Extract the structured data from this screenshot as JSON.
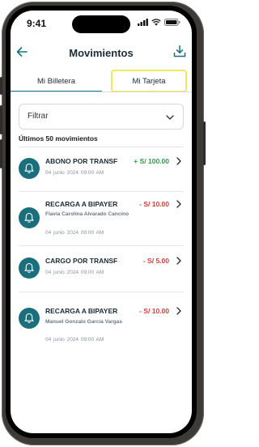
{
  "status_bar": {
    "time": "9:41"
  },
  "header": {
    "title": "Movimientos"
  },
  "tabs": [
    {
      "label": "Mi Billetera",
      "active": true
    },
    {
      "label": "Mi Tarjeta",
      "active": false
    }
  ],
  "filter": {
    "label": "Filtrar"
  },
  "section": {
    "title": "Últimos 50 movimientos"
  },
  "transactions": [
    {
      "title": "ABONO POR TRANSF",
      "amount": "+ S/ 100.00",
      "type": "credit",
      "name": "",
      "date": "04 junio 2024 09:00 AM"
    },
    {
      "title": "RECARGA A BIPAYER",
      "amount": "- S/ 10.00",
      "type": "debit",
      "name": "Flavia Carolina Alvarado Cancino",
      "date": "04 junio 2024 09:00 AM"
    },
    {
      "title": "CARGO POR TRANSF",
      "amount": "- S/ 5.00",
      "type": "debit",
      "name": "",
      "date": "04 junio 2024 09:00 AM"
    },
    {
      "title": "RECARGA A BIPAYER",
      "amount": "- S/ 10.00",
      "type": "debit",
      "name": "Manuel Gonzalo García Vargas",
      "date": "04 junio 2024 09:00 AM"
    }
  ],
  "colors": {
    "accent": "#1b6f7d",
    "credit": "#2e9a48",
    "debit": "#d93a3a",
    "highlight": "#f0ea5a"
  }
}
